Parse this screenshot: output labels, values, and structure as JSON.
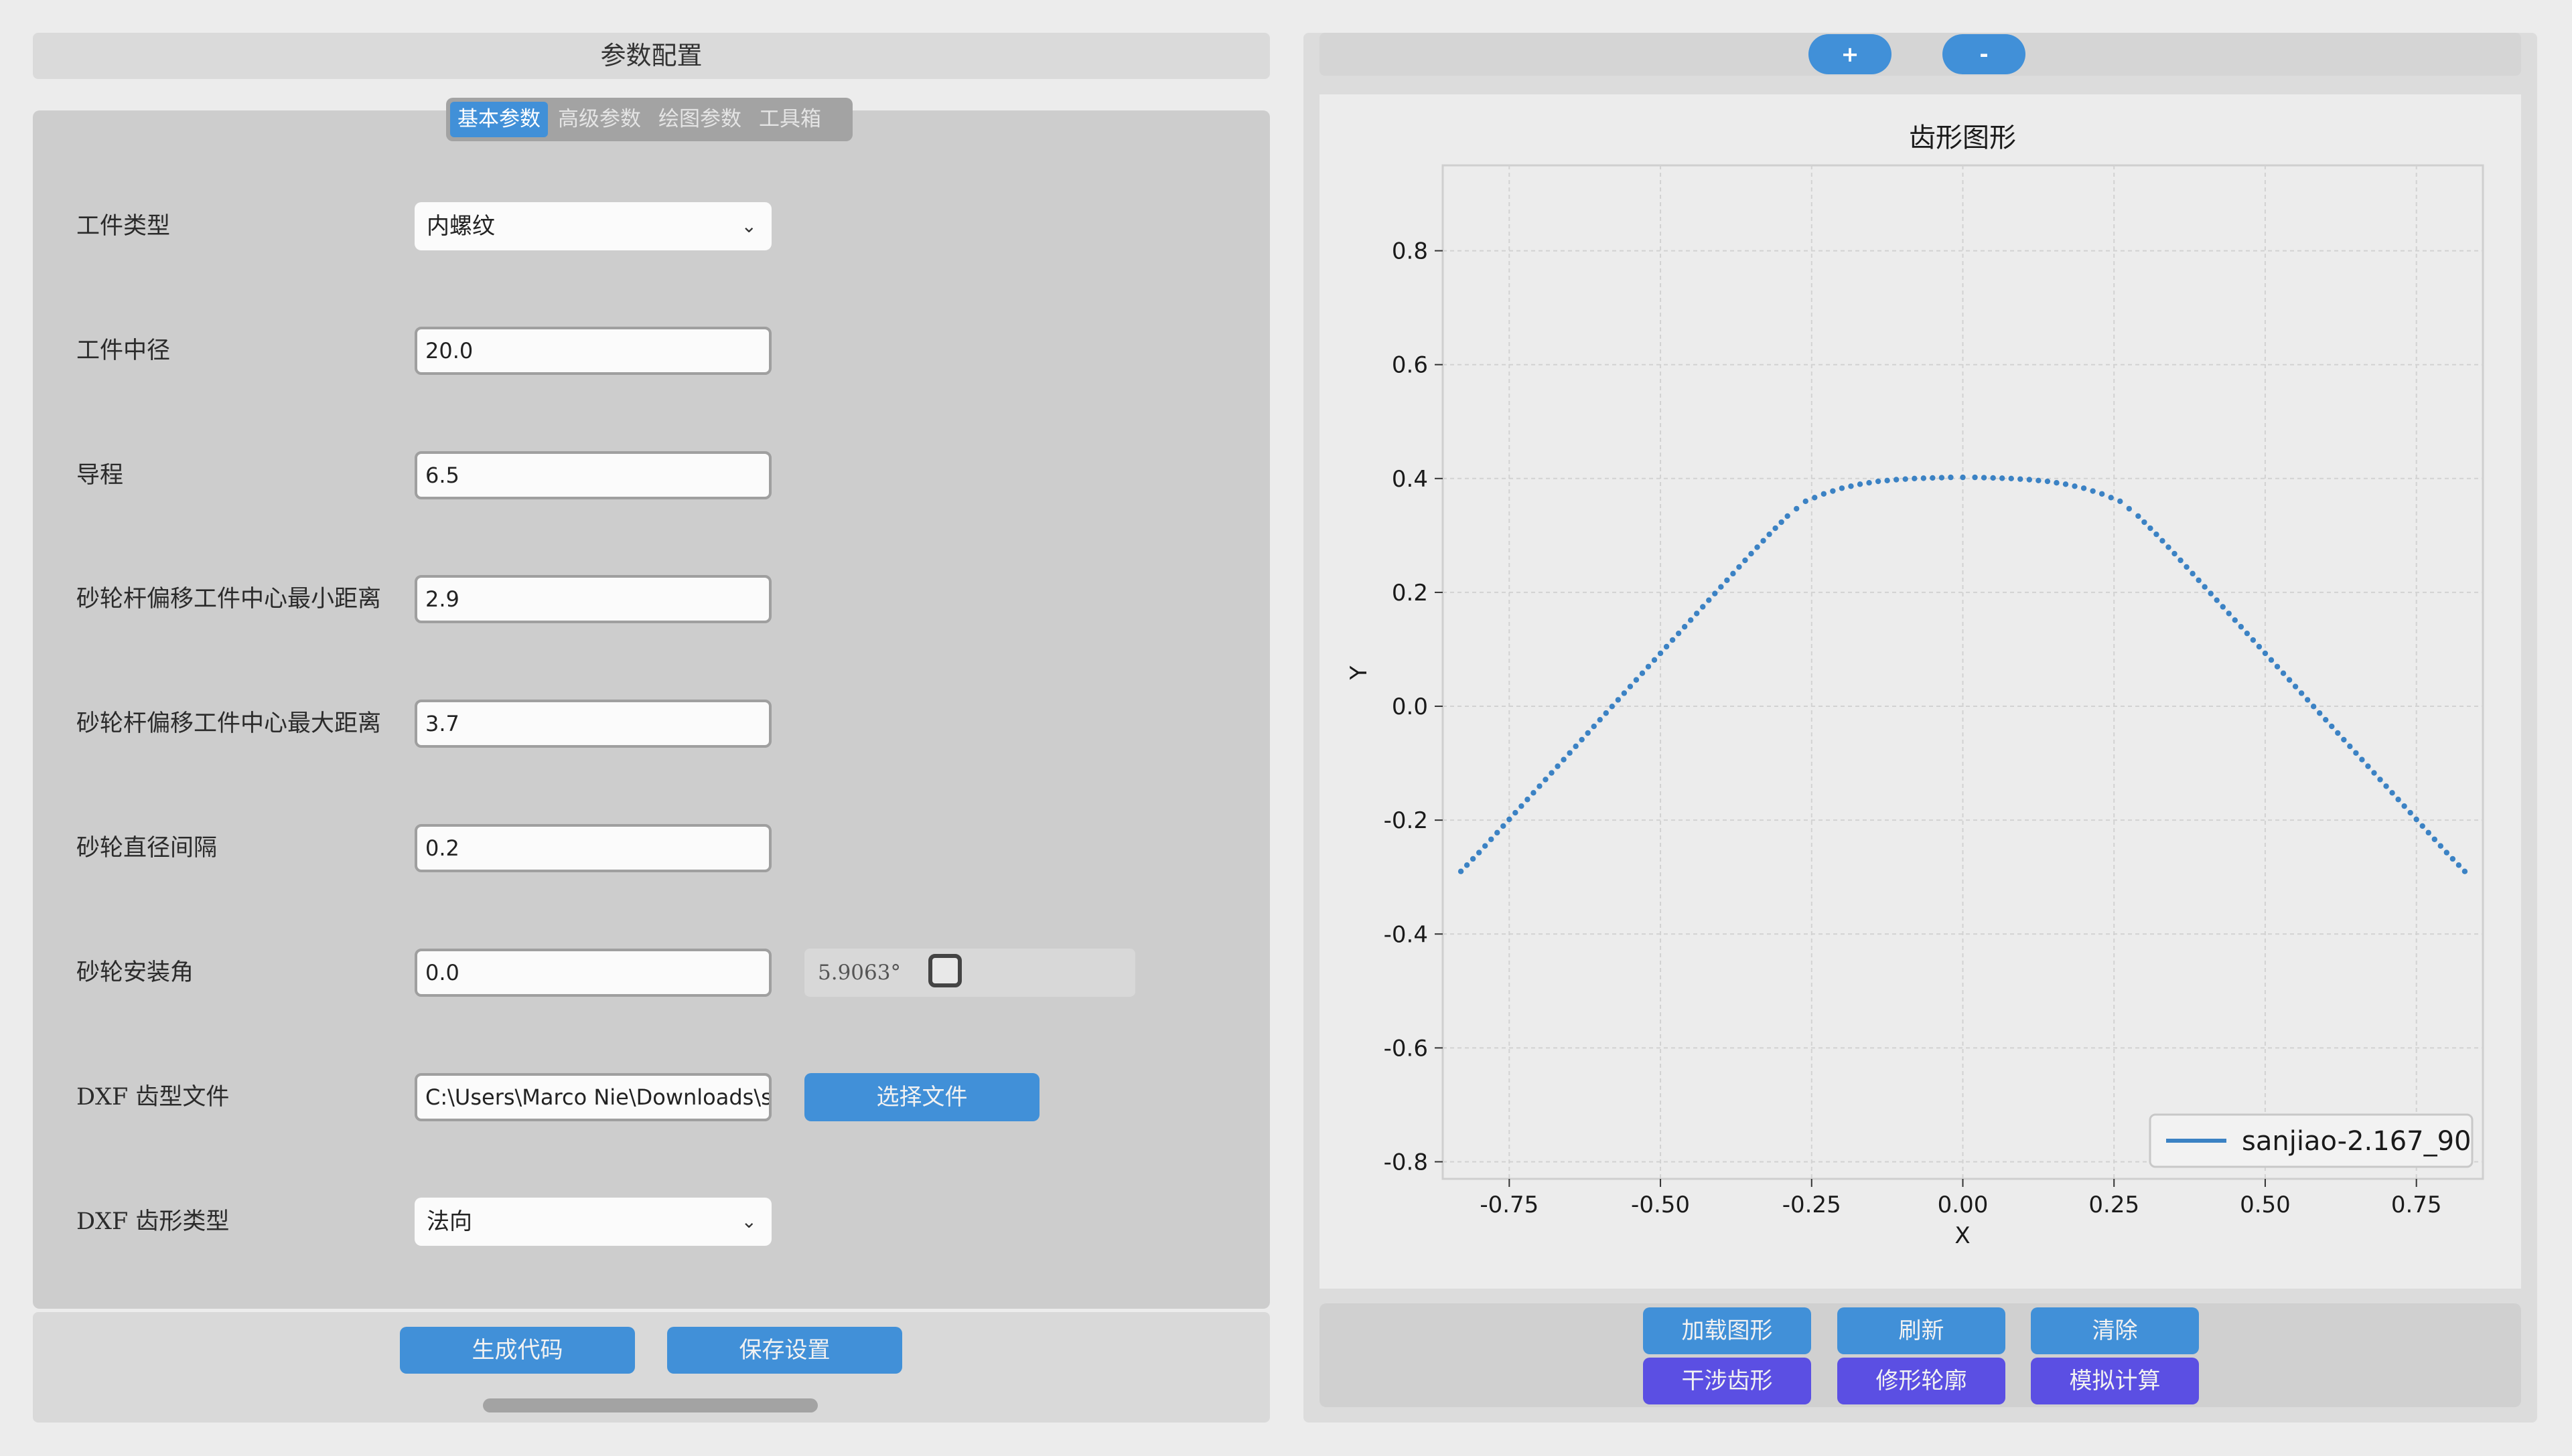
{
  "left": {
    "title": "参数配置",
    "tabs": [
      {
        "label": "基本参数",
        "active": true
      },
      {
        "label": "高级参数",
        "active": false
      },
      {
        "label": "绘图参数",
        "active": false
      },
      {
        "label": "工具箱",
        "active": false
      }
    ],
    "fields": {
      "workpiece_type": {
        "label": "工件类型",
        "value": "内螺纹"
      },
      "pitch_diameter": {
        "label": "工件中径",
        "value": "20.0"
      },
      "lead": {
        "label": "导程",
        "value": "6.5"
      },
      "min_offset": {
        "label": "砂轮杆偏移工件中心最小距离",
        "value": "2.9"
      },
      "max_offset": {
        "label": "砂轮杆偏移工件中心最大距离",
        "value": "3.7"
      },
      "diameter_interval": {
        "label": "砂轮直径间隔",
        "value": "0.2"
      },
      "install_angle": {
        "label": "砂轮安装角",
        "value": "0.0",
        "computed": "5.9063°",
        "checked": false
      },
      "dxf_file": {
        "label": "DXF 齿型文件",
        "value": "C:\\Users\\Marco Nie\\Downloads\\sa",
        "button": "选择文件"
      },
      "dxf_type": {
        "label": "DXF 齿形类型",
        "value": "法向"
      }
    },
    "buttons": {
      "generate": "生成代码",
      "save": "保存设置"
    }
  },
  "right": {
    "zoom_in": "+",
    "zoom_out": "-",
    "actions": {
      "load": "加载图形",
      "refresh": "刷新",
      "clear": "清除",
      "interference": "干涉齿形",
      "modify": "修形轮廓",
      "simulate": "模拟计算"
    }
  },
  "colors": {
    "accent": "#4190d8",
    "purple": "#5b4fe3",
    "series": "#3b82c4"
  },
  "chart_data": {
    "type": "scatter",
    "title": "齿形图形",
    "xlabel": "X",
    "ylabel": "Y",
    "xlim": [
      -0.86,
      0.86
    ],
    "ylim": [
      -0.83,
      0.95
    ],
    "xticks": [
      -0.75,
      -0.5,
      -0.25,
      0.0,
      0.25,
      0.5,
      0.75
    ],
    "xtick_labels": [
      "-0.75",
      "-0.50",
      "-0.25",
      "0.00",
      "0.25",
      "0.50",
      "0.75"
    ],
    "yticks": [
      0.8,
      0.6,
      0.4,
      0.2,
      0.0,
      -0.2,
      -0.4,
      -0.6,
      -0.8
    ],
    "ytick_labels": [
      "0.8",
      "0.6",
      "0.4",
      "0.2",
      "0.0",
      "-0.2",
      "-0.4",
      "-0.6",
      "-0.8"
    ],
    "grid": true,
    "legend": "bottom-right",
    "series": [
      {
        "name": "sanjiao-2.167_90",
        "points": [
          [
            -0.83,
            -0.29
          ],
          [
            -0.8,
            -0.257
          ],
          [
            -0.77,
            -0.222
          ],
          [
            -0.74,
            -0.187
          ],
          [
            -0.71,
            -0.152
          ],
          [
            -0.68,
            -0.117
          ],
          [
            -0.65,
            -0.082
          ],
          [
            -0.62,
            -0.047
          ],
          [
            -0.59,
            -0.012
          ],
          [
            -0.56,
            0.023
          ],
          [
            -0.53,
            0.058
          ],
          [
            -0.5,
            0.093
          ],
          [
            -0.47,
            0.128
          ],
          [
            -0.44,
            0.163
          ],
          [
            -0.41,
            0.198
          ],
          [
            -0.38,
            0.233
          ],
          [
            -0.35,
            0.268
          ],
          [
            -0.32,
            0.302
          ],
          [
            -0.29,
            0.334
          ],
          [
            -0.26,
            0.36
          ],
          [
            -0.23,
            0.373
          ],
          [
            -0.2,
            0.383
          ],
          [
            -0.17,
            0.39
          ],
          [
            -0.14,
            0.395
          ],
          [
            -0.11,
            0.398
          ],
          [
            -0.08,
            0.4
          ],
          [
            -0.05,
            0.401
          ],
          [
            -0.02,
            0.402
          ],
          [
            0.0,
            0.402
          ],
          [
            0.02,
            0.402
          ],
          [
            0.05,
            0.401
          ],
          [
            0.08,
            0.4
          ],
          [
            0.11,
            0.398
          ],
          [
            0.14,
            0.395
          ],
          [
            0.17,
            0.39
          ],
          [
            0.2,
            0.383
          ],
          [
            0.23,
            0.373
          ],
          [
            0.26,
            0.36
          ],
          [
            0.29,
            0.334
          ],
          [
            0.32,
            0.302
          ],
          [
            0.35,
            0.268
          ],
          [
            0.38,
            0.233
          ],
          [
            0.41,
            0.198
          ],
          [
            0.44,
            0.163
          ],
          [
            0.47,
            0.128
          ],
          [
            0.5,
            0.093
          ],
          [
            0.53,
            0.058
          ],
          [
            0.56,
            0.023
          ],
          [
            0.59,
            -0.012
          ],
          [
            0.62,
            -0.047
          ],
          [
            0.65,
            -0.082
          ],
          [
            0.68,
            -0.117
          ],
          [
            0.71,
            -0.152
          ],
          [
            0.74,
            -0.187
          ],
          [
            0.77,
            -0.222
          ],
          [
            0.8,
            -0.257
          ],
          [
            0.83,
            -0.29
          ]
        ]
      }
    ]
  }
}
